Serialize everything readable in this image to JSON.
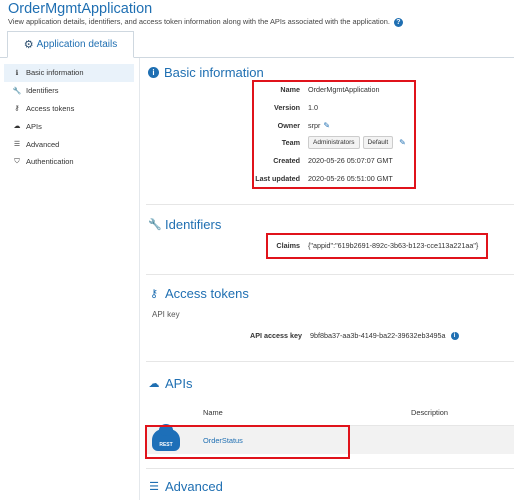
{
  "page": {
    "title": "OrderMgmtApplication",
    "subtitle": "View application details, identifiers, and access token information along with the APIs associated with the application."
  },
  "tabs": [
    {
      "label": "Application details",
      "icon": "gears-icon"
    }
  ],
  "sidebar": {
    "items": [
      {
        "label": "Basic information",
        "icon": "info-icon",
        "active": true
      },
      {
        "label": "Identifiers",
        "icon": "wrench-icon"
      },
      {
        "label": "Access tokens",
        "icon": "key-icon"
      },
      {
        "label": "APIs",
        "icon": "cloud-icon"
      },
      {
        "label": "Advanced",
        "icon": "server-icon"
      },
      {
        "label": "Authentication",
        "icon": "shield-icon"
      }
    ]
  },
  "basic_info": {
    "title": "Basic information",
    "name_label": "Name",
    "name": "OrderMgmtApplication",
    "version_label": "Version",
    "version": "1.0",
    "owner_label": "Owner",
    "owner": "srpr",
    "team_label": "Team",
    "team": [
      "Administrators",
      "Default"
    ],
    "created_label": "Created",
    "created": "2020-05-26 05:07:07 GMT",
    "updated_label": "Last updated",
    "updated": "2020-05-26 05:51:00 GMT"
  },
  "identifiers": {
    "title": "Identifiers",
    "claims_label": "Claims",
    "claims": "{\"appid\":\"619b2691-892c-3b63-b123-cce113a221aa\"}"
  },
  "access_tokens": {
    "title": "Access tokens",
    "subtitle": "API key",
    "key_label": "API access key",
    "key": "9bf8ba37-aa3b-4149-ba22-39632eb3495a"
  },
  "apis": {
    "title": "APIs",
    "col_name": "Name",
    "col_desc": "Description",
    "rows": [
      {
        "type": "REST",
        "name": "OrderStatus"
      }
    ]
  },
  "advanced": {
    "title": "Advanced"
  },
  "colors": {
    "accent": "#1f6fb2",
    "highlight": "#e0131b"
  }
}
